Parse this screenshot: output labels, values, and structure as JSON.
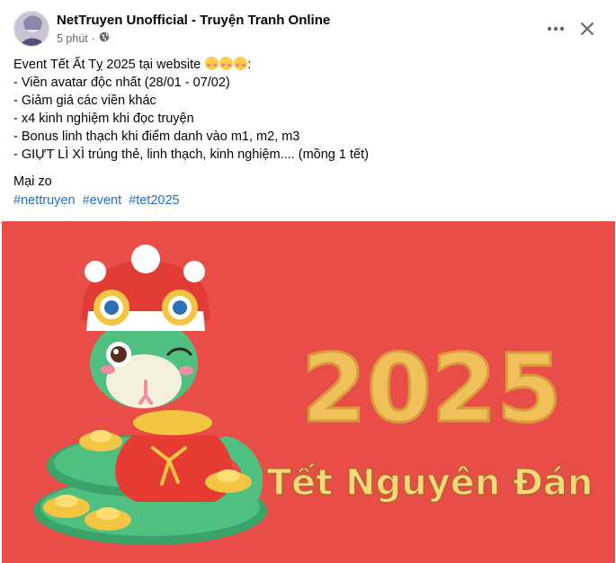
{
  "post": {
    "author": "NetTruyen Unofficial - Truyện Tranh Online",
    "time": "5 phút",
    "privacy_icon": "globe-icon",
    "menu_icon": "more-horizontal-icon",
    "close_icon": "close-icon",
    "intro": "Event Tết Ất Tỵ 2025 tại website",
    "intro_emoji": "smiling-face-with-hearts-emoji",
    "bullets": [
      "- Viền avatar độc nhất (28/01 - 07/02)",
      "- Giảm giá các viền khác",
      "- x4 kinh nghiệm khi đọc truyện",
      "- Bonus linh thạch khi điểm danh vào m1, m2, m3",
      "- GIỰT LÌ XÌ trúng thẻ, linh thạch, kinh nghiệm.... (mồng 1 tết)"
    ],
    "closing": "Mại zo",
    "hashtags": [
      "#nettruyen",
      "#event",
      "#tet2025"
    ]
  },
  "banner": {
    "year": "2025",
    "subtitle": "Tết Nguyên Đán",
    "background_color": "#e84d48",
    "year_color": "#f0c15a",
    "subtitle_color": "#f5d97a"
  }
}
